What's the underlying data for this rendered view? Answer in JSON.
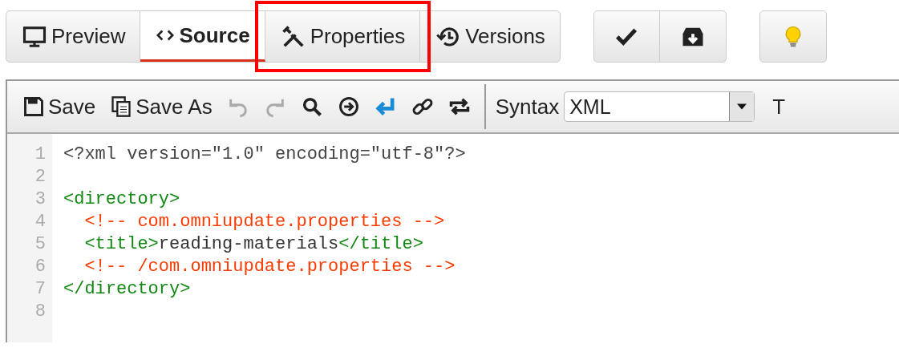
{
  "tabs": [
    {
      "label": "Preview",
      "selected": false,
      "highlighted": false
    },
    {
      "label": "Source",
      "selected": true,
      "highlighted": false
    },
    {
      "label": "Properties",
      "selected": false,
      "highlighted": true
    },
    {
      "label": "Versions",
      "selected": false,
      "highlighted": false
    }
  ],
  "toolbar": {
    "items": [
      {
        "label": "Save",
        "disabled": false
      },
      {
        "label": "Save As",
        "disabled": false
      },
      {
        "disabled": true
      },
      {
        "disabled": true
      },
      {
        "disabled": false
      },
      {
        "disabled": false
      },
      {
        "disabled": false
      },
      {
        "disabled": false
      },
      {
        "disabled": false
      }
    ],
    "syntax_label": "Syntax",
    "syntax_value": "XML",
    "cut_label": "T"
  },
  "code_lines": [
    {
      "number": "1",
      "segments": [
        {
          "kind": "decl",
          "text": "<?xml version=\"1.0\" encoding=\"utf-8\"?>"
        }
      ]
    },
    {
      "number": "2"
    },
    {
      "number": "3",
      "segments": [
        {
          "kind": "tag",
          "text": "<directory>"
        }
      ]
    },
    {
      "number": "4",
      "segments": [
        {
          "kind": "comment",
          "text": "  <!-- com.omniupdate.properties -->"
        }
      ]
    },
    {
      "number": "5",
      "segments": [
        {
          "kind": "tag",
          "text": "  <title>"
        },
        {
          "kind": "text",
          "text": "reading-materials"
        },
        {
          "kind": "tag",
          "text": "</title>"
        }
      ]
    },
    {
      "number": "6",
      "segments": [
        {
          "kind": "comment",
          "text": "  <!-- /com.omniupdate.properties -->"
        }
      ]
    },
    {
      "number": "7",
      "segments": [
        {
          "kind": "tag",
          "text": "</directory>"
        }
      ]
    },
    {
      "number": "8"
    }
  ]
}
